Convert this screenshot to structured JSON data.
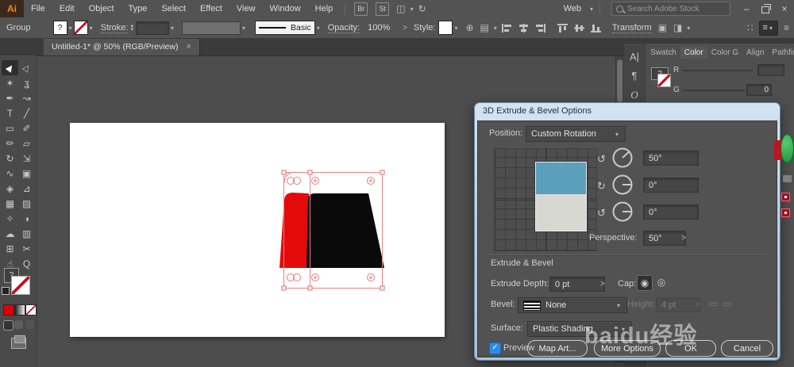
{
  "icons": {
    "chevron": "▾",
    "up": "▴",
    "down": "▾",
    "arrow": ">",
    "close": "×",
    "minimize": "–",
    "check": "✓",
    "globe": "⊕",
    "doc": "▤",
    "transform_box": "▣",
    "clip_box": "◨",
    "panel_list": "≡",
    "dots": "∷",
    "workspace": "◫",
    "sync": "↻",
    "cap_on": "◉",
    "cap_off": "◎",
    "rotate_x": "↺",
    "rotate_y": "↻",
    "rotate_z": "↺",
    "height_btn": "▭",
    "question": "?"
  },
  "menubar": {
    "logo": "Ai",
    "items": [
      "File",
      "Edit",
      "Object",
      "Type",
      "Select",
      "Effect",
      "View",
      "Window",
      "Help"
    ],
    "bridge_label": "Br",
    "stock_label": "St",
    "workspace_value": "Web",
    "search_placeholder": "Search Adobe Stock"
  },
  "controlbar": {
    "context_label": "Group",
    "fill_value": "?",
    "stroke_label": "Stroke:",
    "brush_value": "Basic",
    "opacity_label": "Opacity:",
    "opacity_value": "100%",
    "style_label": "Style:",
    "transform_label": "Transform"
  },
  "tabbar": {
    "doc_title": "Untitled-1* @ 50% (RGB/Preview)"
  },
  "tools": [
    {
      "name": "selection",
      "g": "▶"
    },
    {
      "name": "direct-selection",
      "g": "▷"
    },
    {
      "name": "magic-wand",
      "g": "✶"
    },
    {
      "name": "lasso",
      "g": "ʓ"
    },
    {
      "name": "pen",
      "g": "✒"
    },
    {
      "name": "curvature",
      "g": "↝"
    },
    {
      "name": "type",
      "g": "T"
    },
    {
      "name": "line-segment",
      "g": "╱"
    },
    {
      "name": "rectangle",
      "g": "▭"
    },
    {
      "name": "paintbrush",
      "g": "✐"
    },
    {
      "name": "pencil",
      "g": "✏"
    },
    {
      "name": "eraser",
      "g": "▱"
    },
    {
      "name": "rotate",
      "g": "↻"
    },
    {
      "name": "scale",
      "g": "⇲"
    },
    {
      "name": "width",
      "g": "∿"
    },
    {
      "name": "free-transform",
      "g": "▣"
    },
    {
      "name": "shape-builder",
      "g": "◈"
    },
    {
      "name": "perspective-grid",
      "g": "⊿"
    },
    {
      "name": "mesh",
      "g": "▦"
    },
    {
      "name": "gradient",
      "g": "▨"
    },
    {
      "name": "eyedropper",
      "g": "✧"
    },
    {
      "name": "blend",
      "g": "◑"
    },
    {
      "name": "symbol-sprayer",
      "g": "☁"
    },
    {
      "name": "column-graph",
      "g": "▥"
    },
    {
      "name": "artboard",
      "g": "⊞"
    },
    {
      "name": "slice",
      "g": "✂"
    },
    {
      "name": "hand",
      "g": "☝"
    },
    {
      "name": "zoom",
      "g": "Q"
    }
  ],
  "panels": {
    "tabs": [
      "Swatch",
      "Color",
      "Color G",
      "Align",
      "Pathfin"
    ],
    "side_icons": [
      "A|",
      "¶",
      "O"
    ],
    "color": {
      "fill_value": "?",
      "r_label": "R",
      "g_label": "G",
      "g_value": "0"
    }
  },
  "dialog": {
    "title": "3D Extrude & Bevel Options",
    "position_label": "Position:",
    "position_value": "Custom Rotation",
    "rotate_x_value": "50°",
    "rotate_y_value": "0°",
    "rotate_z_value": "0°",
    "perspective_label": "Perspective:",
    "perspective_value": "50°",
    "section_label": "Extrude & Bevel",
    "extrude_depth_label": "Extrude Depth:",
    "extrude_depth_value": "0 pt",
    "cap_label": "Cap:",
    "bevel_label": "Bevel:",
    "bevel_value": "None",
    "height_label": "Height:",
    "height_value": "4 pt",
    "surface_label": "Surface:",
    "surface_value": "Plastic Shading",
    "preview_label": "Preview",
    "map_art_button": "Map Art...",
    "more_options_button": "More Options",
    "ok_button": "OK",
    "cancel_button": "Cancel"
  },
  "watermark": "baidu经验",
  "colors": {
    "shape_red": "#e40b0b",
    "shape_black": "#0a0a0a",
    "selection_pink": "#ef8181",
    "cube_blue": "#5aa0bc",
    "cube_gray": "#d8d8d3",
    "checkbox_blue": "#2a8ceb",
    "aero_border": "#b9d0e6",
    "ai_orange": "#ff8a00",
    "ui_bg": "#535353"
  }
}
